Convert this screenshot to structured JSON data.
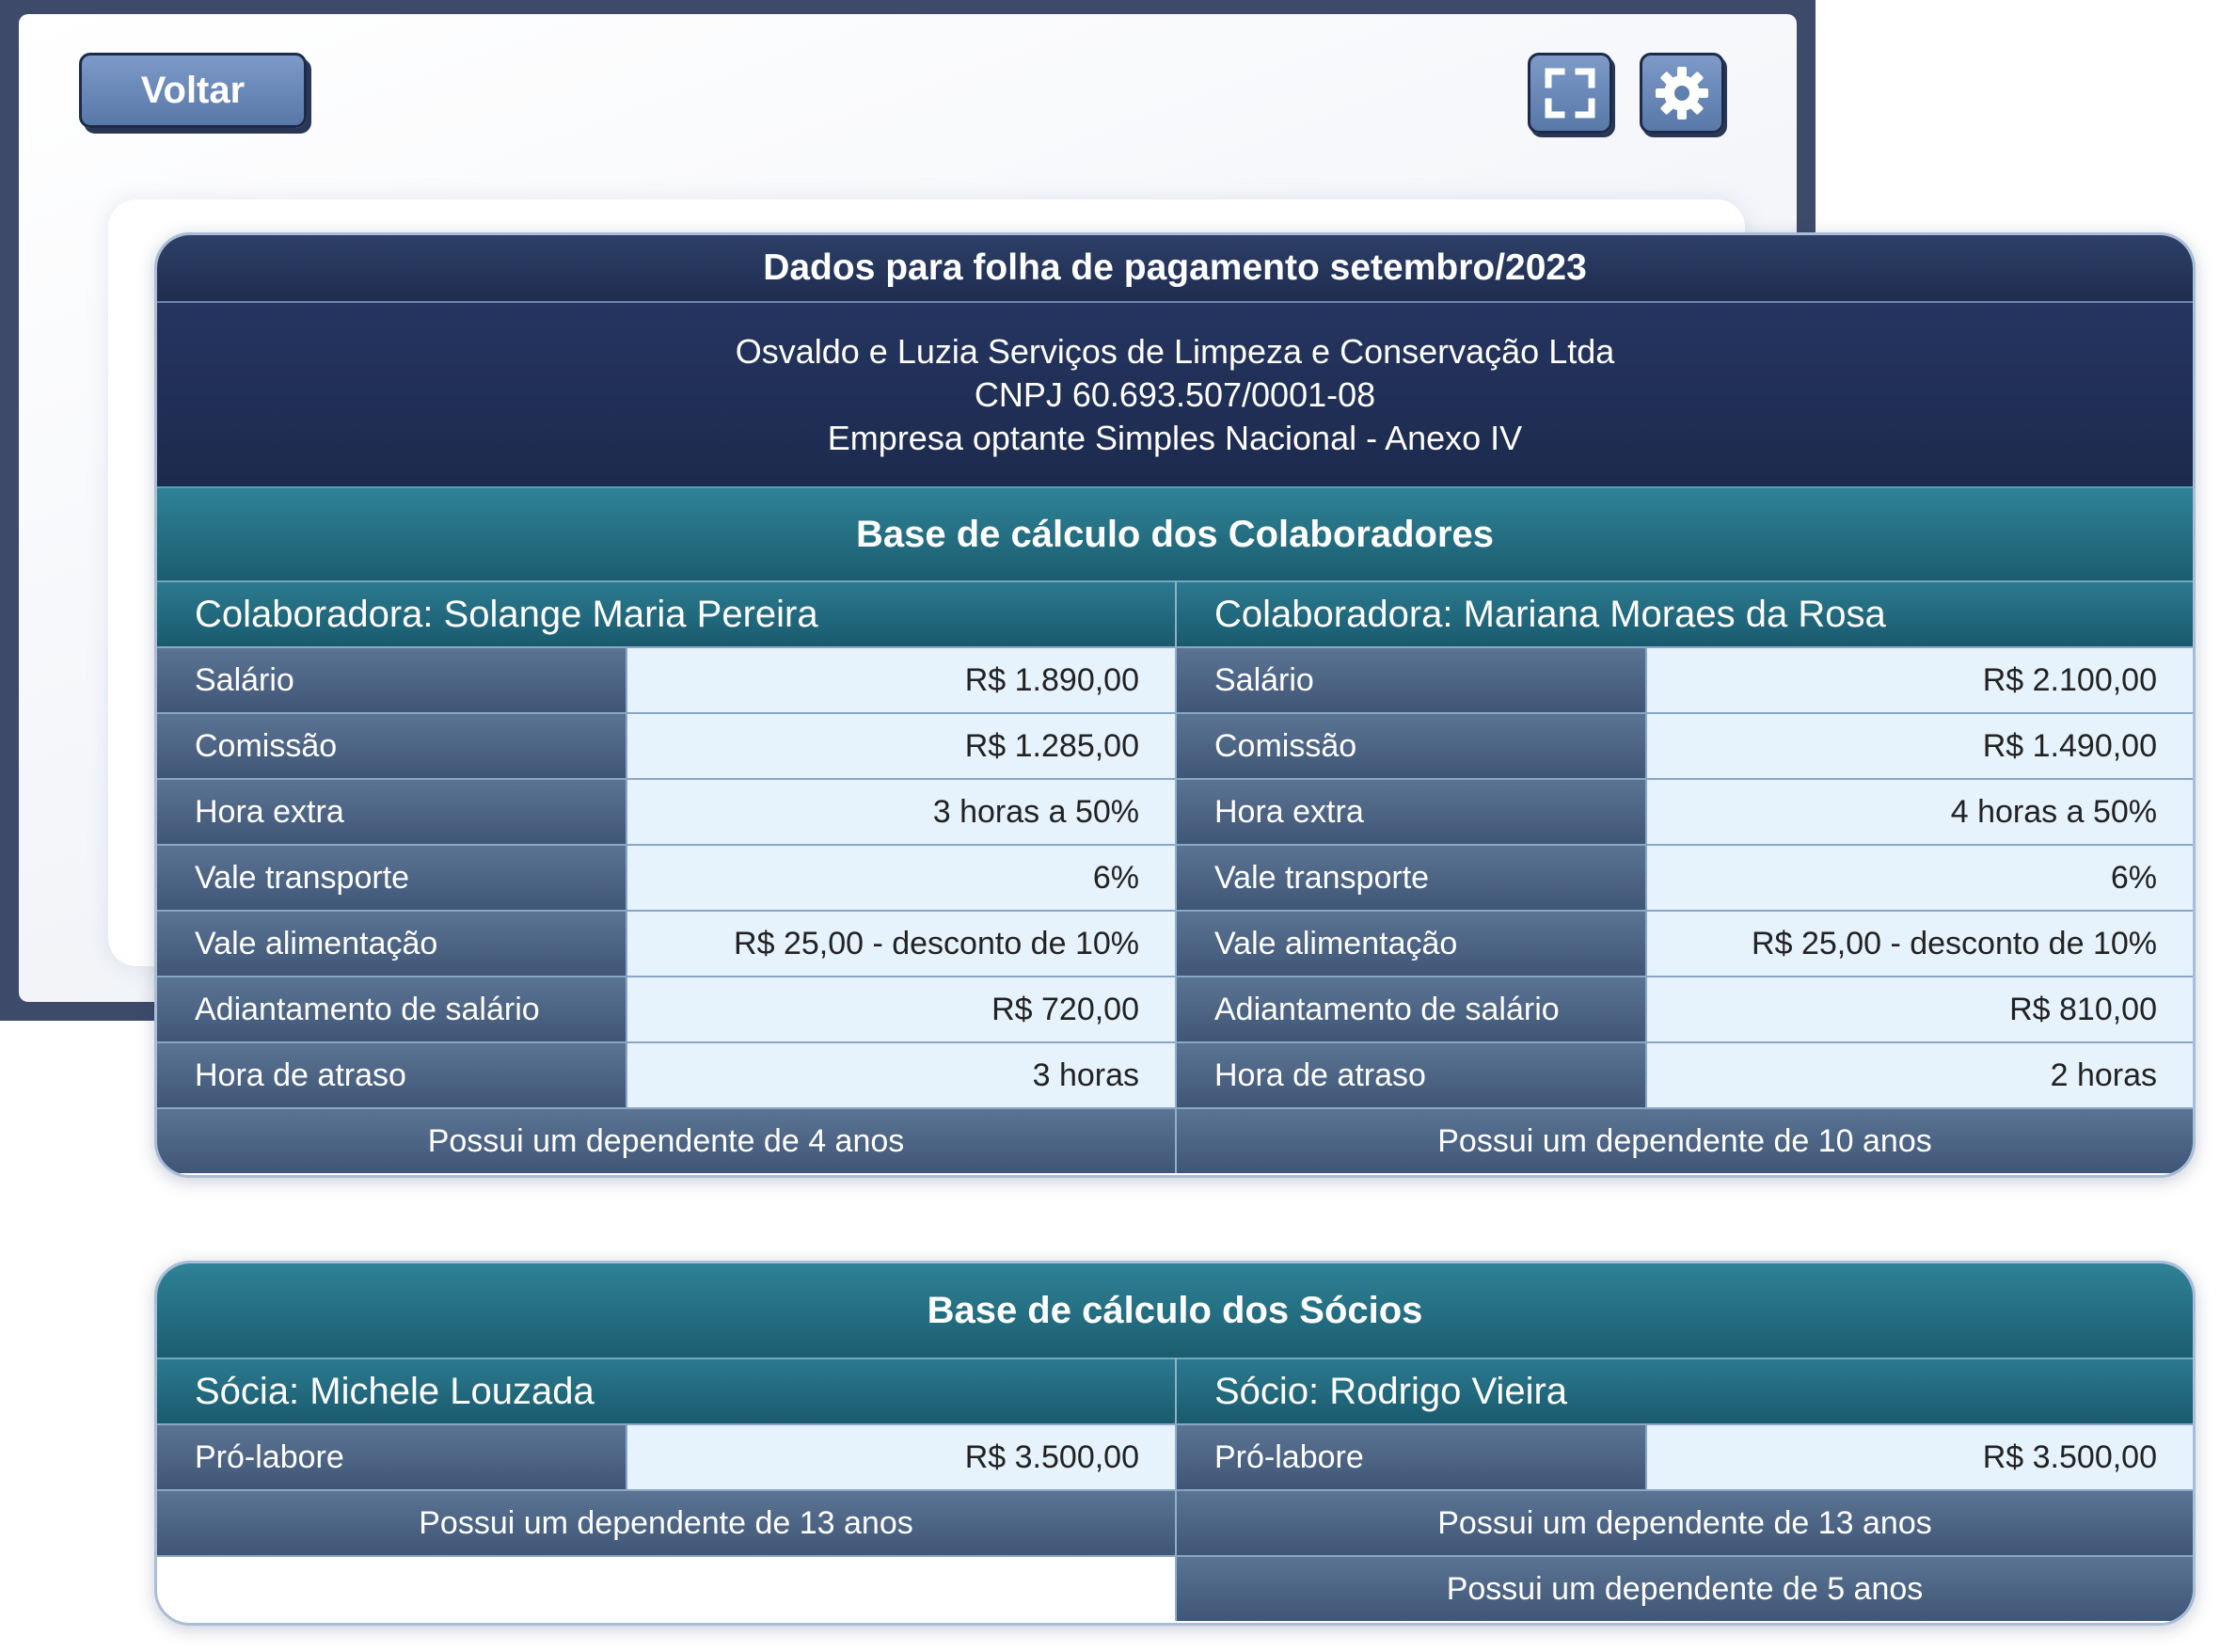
{
  "toolbar": {
    "back_label": "Voltar",
    "fullscreen_icon": "fullscreen-icon",
    "settings_icon": "gear-icon"
  },
  "header": {
    "title": "Dados para folha de pagamento setembro/2023",
    "company_name": "Osvaldo e Luzia Serviços de Limpeza e Conservação Ltda",
    "cnpj": "CNPJ 60.693.507/0001-08",
    "regime": "Empresa optante Simples Nacional - Anexo IV"
  },
  "colaboradores": {
    "title": "Base de cálculo dos Colaboradores",
    "people": [
      {
        "heading": "Colaboradora: Solange Maria Pereira",
        "rows": [
          {
            "label": "Salário",
            "value": "R$ 1.890,00"
          },
          {
            "label": "Comissão",
            "value": "R$ 1.285,00"
          },
          {
            "label": "Hora extra",
            "value": "3 horas a 50%"
          },
          {
            "label": "Vale transporte",
            "value": "6%"
          },
          {
            "label": "Vale alimentação",
            "value": "R$ 25,00 - desconto de 10%"
          },
          {
            "label": "Adiantamento de salário",
            "value": "R$ 720,00"
          },
          {
            "label": "Hora de atraso",
            "value": "3 horas"
          }
        ],
        "dependents": [
          "Possui um dependente de 4 anos"
        ]
      },
      {
        "heading": "Colaboradora: Mariana Moraes da Rosa",
        "rows": [
          {
            "label": "Salário",
            "value": "R$ 2.100,00"
          },
          {
            "label": "Comissão",
            "value": "R$ 1.490,00"
          },
          {
            "label": "Hora extra",
            "value": "4 horas a 50%"
          },
          {
            "label": "Vale transporte",
            "value": "6%"
          },
          {
            "label": "Vale alimentação",
            "value": "R$ 25,00 - desconto de 10%"
          },
          {
            "label": "Adiantamento de salário",
            "value": "R$ 810,00"
          },
          {
            "label": "Hora de atraso",
            "value": "2 horas"
          }
        ],
        "dependents": [
          "Possui um dependente de 10 anos"
        ]
      }
    ]
  },
  "socios": {
    "title": "Base de cálculo dos Sócios",
    "people": [
      {
        "heading": "Sócia: Michele Louzada",
        "rows": [
          {
            "label": "Pró-labore",
            "value": "R$ 3.500,00"
          }
        ],
        "dependents": [
          "Possui um dependente de 13 anos"
        ]
      },
      {
        "heading": "Sócio: Rodrigo Vieira",
        "rows": [
          {
            "label": "Pró-labore",
            "value": "R$ 3.500,00"
          }
        ],
        "dependents": [
          "Possui um dependente de 13 anos",
          "Possui um dependente de 5 anos"
        ]
      }
    ]
  }
}
